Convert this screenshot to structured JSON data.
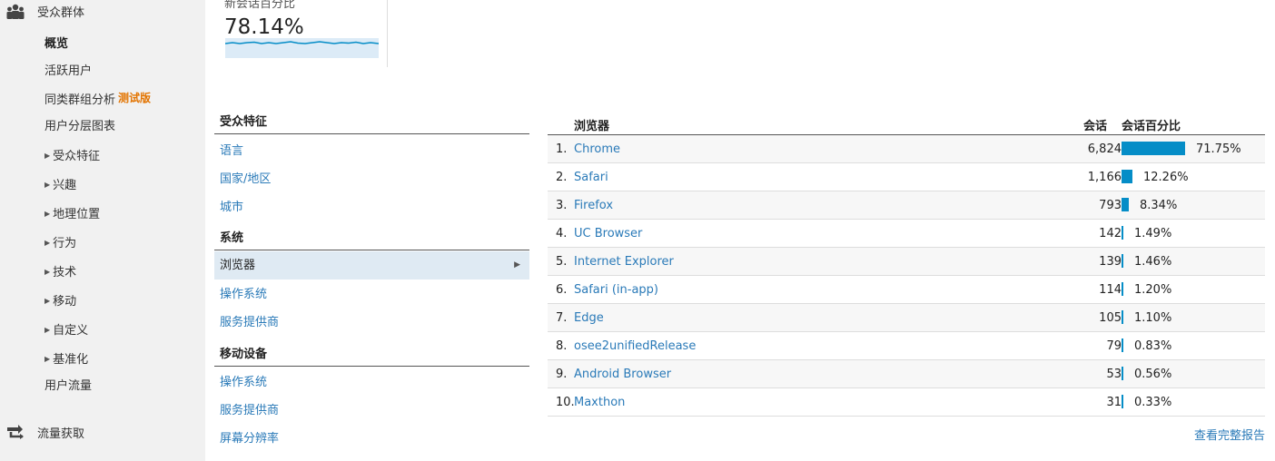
{
  "sidebar": {
    "audience": {
      "label": "受众群体",
      "icon": "audience-people-icon"
    },
    "items": {
      "overview": "概览",
      "active_users": "活跃用户",
      "cohort": "同类群组分析",
      "cohort_badge": "测试版",
      "user_explorer": "用户分层图表",
      "demographics": "受众特征",
      "interests": "兴趣",
      "geo": "地理位置",
      "behavior": "行为",
      "technology": "技术",
      "mobile": "移动",
      "custom": "自定义",
      "benchmarking": "基准化",
      "users_flow": "用户流量"
    },
    "acquisition": {
      "label": "流量获取",
      "icon": "acquisition-arrows-icon"
    }
  },
  "metric": {
    "label": "新会话百分比",
    "value": "78.14%",
    "color": "#058dc7"
  },
  "dimensions": {
    "demographics_header": "受众特征",
    "language": "语言",
    "country": "国家/地区",
    "city": "城市",
    "system_header": "系统",
    "browser": "浏览器",
    "os": "操作系统",
    "isp": "服务提供商",
    "mobile_header": "移动设备",
    "mobile_os": "操作系统",
    "mobile_isp": "服务提供商",
    "screen_resolution": "屏幕分辨率"
  },
  "table": {
    "headers": {
      "browser": "浏览器",
      "sessions": "会话",
      "pct": "会话百分比"
    },
    "bar_color": "#058dc7",
    "rows": [
      {
        "idx": "1.",
        "name": "Chrome",
        "sessions": "6,824",
        "pct": "71.75%",
        "share": 71.75
      },
      {
        "idx": "2.",
        "name": "Safari",
        "sessions": "1,166",
        "pct": "12.26%",
        "share": 12.26
      },
      {
        "idx": "3.",
        "name": "Firefox",
        "sessions": "793",
        "pct": "8.34%",
        "share": 8.34
      },
      {
        "idx": "4.",
        "name": "UC Browser",
        "sessions": "142",
        "pct": "1.49%",
        "share": 1.49
      },
      {
        "idx": "5.",
        "name": "Internet Explorer",
        "sessions": "139",
        "pct": "1.46%",
        "share": 1.46
      },
      {
        "idx": "6.",
        "name": "Safari (in-app)",
        "sessions": "114",
        "pct": "1.20%",
        "share": 1.2
      },
      {
        "idx": "7.",
        "name": "Edge",
        "sessions": "105",
        "pct": "1.10%",
        "share": 1.1
      },
      {
        "idx": "8.",
        "name": "osee2unifiedRelease",
        "sessions": "79",
        "pct": "0.83%",
        "share": 0.83
      },
      {
        "idx": "9.",
        "name": "Android Browser",
        "sessions": "53",
        "pct": "0.56%",
        "share": 0.56
      },
      {
        "idx": "10.",
        "name": "Maxthon",
        "sessions": "31",
        "pct": "0.33%",
        "share": 0.33
      }
    ],
    "full_report_link": "查看完整报告"
  }
}
